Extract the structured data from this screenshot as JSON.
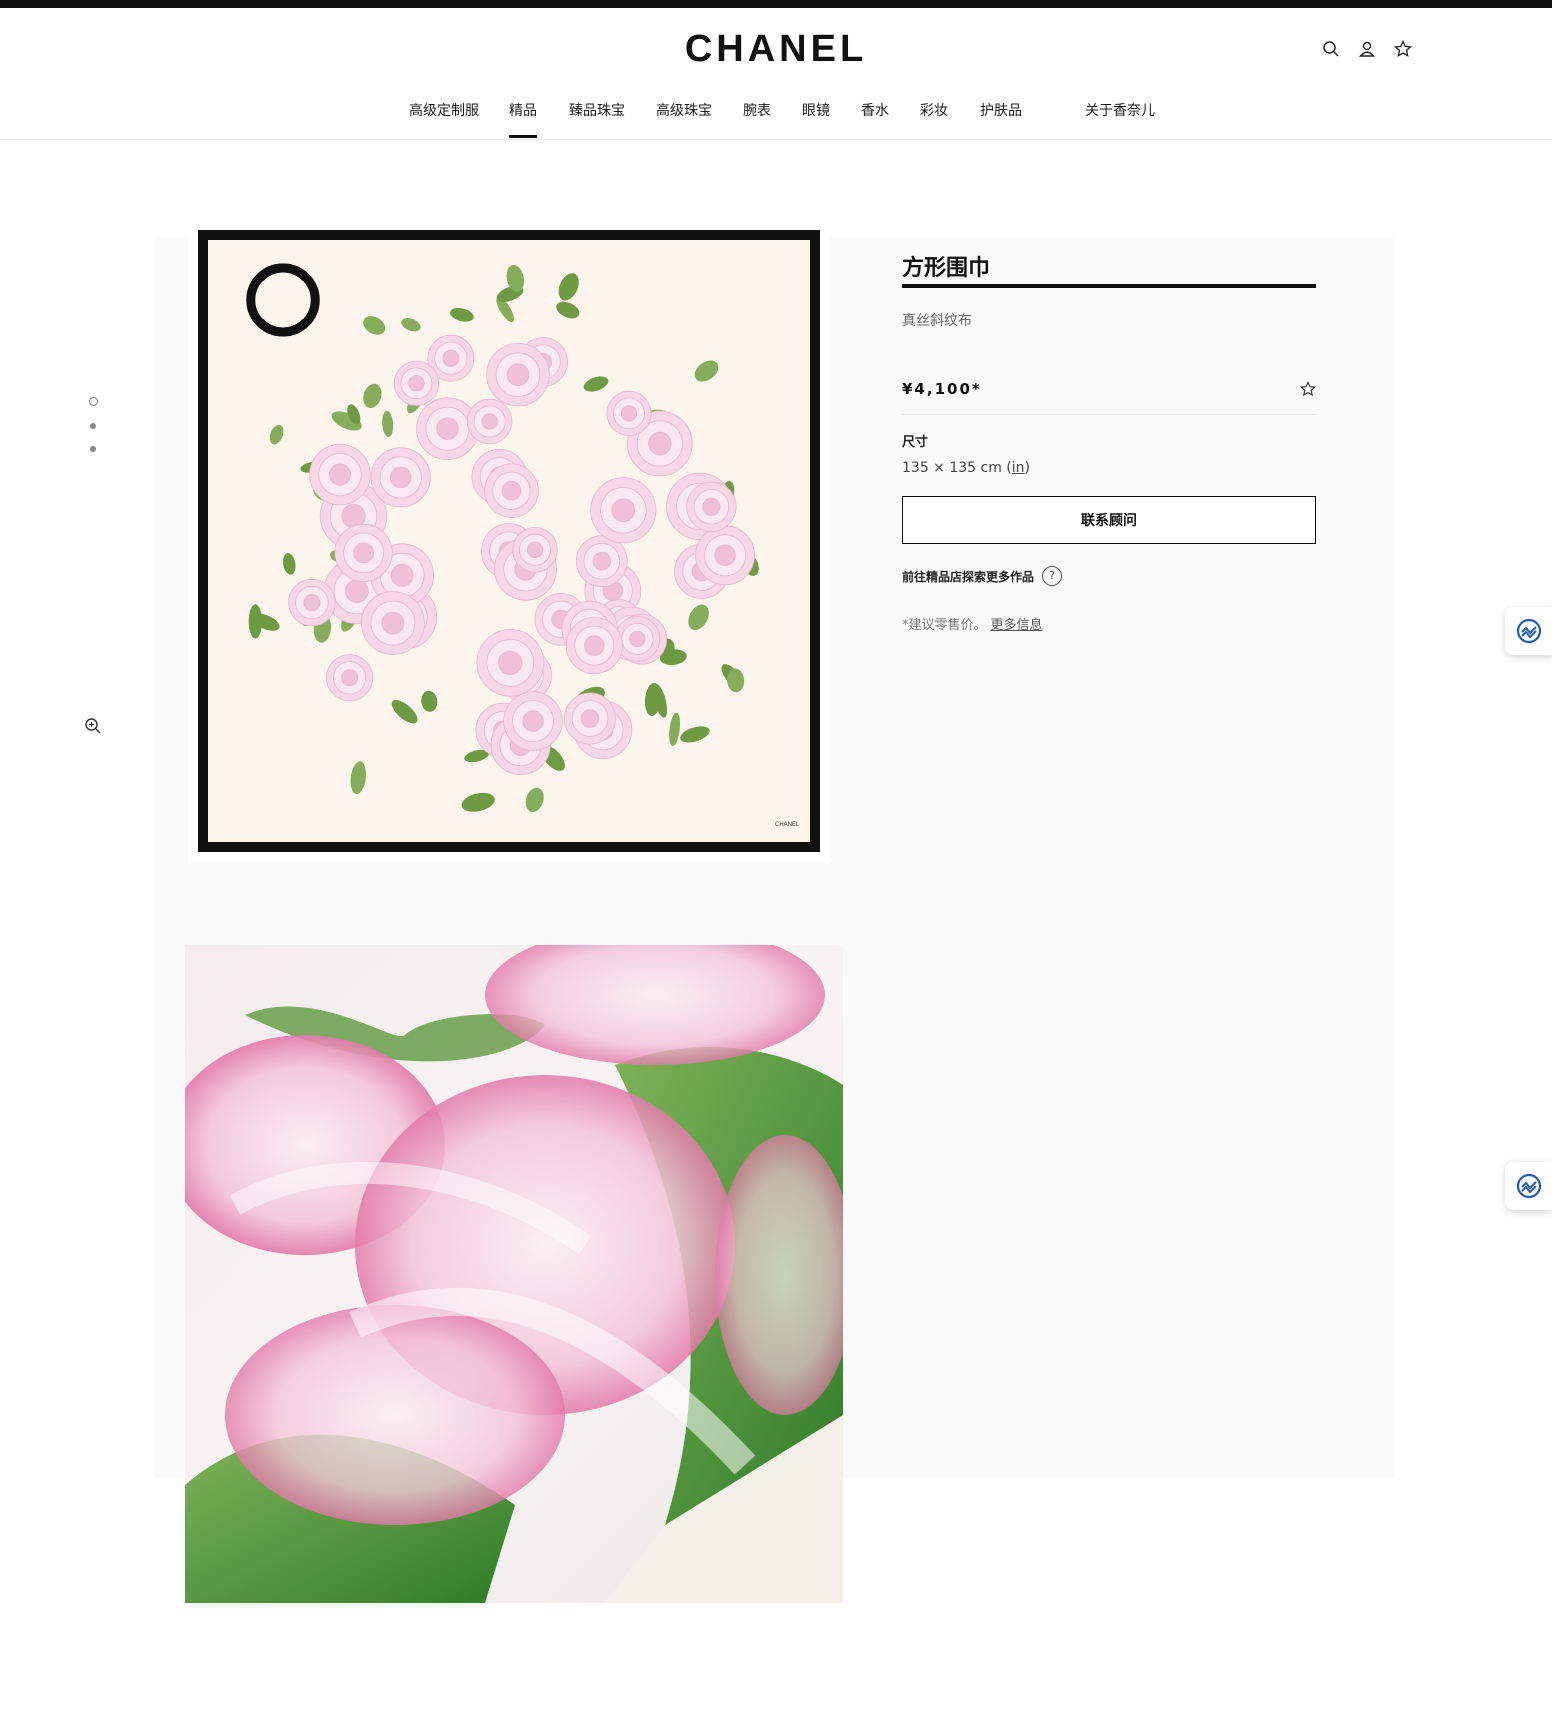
{
  "header": {
    "brand": "CHANEL",
    "icons": [
      "search-icon",
      "account-icon",
      "wishlist-star-icon"
    ]
  },
  "nav": {
    "items": [
      "高级定制服",
      "精品",
      "臻品珠宝",
      "高级珠宝",
      "腕表",
      "眼镜",
      "香水",
      "彩妆",
      "护肤品",
      "关于香奈儿"
    ],
    "active": "精品"
  },
  "gallery": {
    "dots": 3,
    "active_dot": 1,
    "icons": [
      "zoom-in-icon"
    ],
    "image_1": "方形围巾 – 白色山茶花印花，黑色边框",
    "image_2": "围巾面料细节 – 粉色山茶花与绿叶"
  },
  "product": {
    "title": "方形围巾",
    "material": "真丝斜纹布",
    "price": "¥4,100*",
    "size_label": "尺寸",
    "size_value": "135 × 135 cm (",
    "size_unit": "in",
    "size_close": ")",
    "contact_label": "联系顾问",
    "boutique_text": "前往精品店探索更多作品",
    "help_glyph": "?",
    "note_text": "*建议零售价。",
    "note_link": "更多信息"
  },
  "floating": {
    "icons": [
      "chat-assistant-icon",
      "chat-assistant-icon"
    ]
  },
  "colors": {
    "text": "#1d1d1d",
    "muted": "#777777",
    "border": "#111111",
    "leaf": "#6e9a44",
    "petal": "#f3c9df",
    "cream": "#fbf5ee"
  }
}
